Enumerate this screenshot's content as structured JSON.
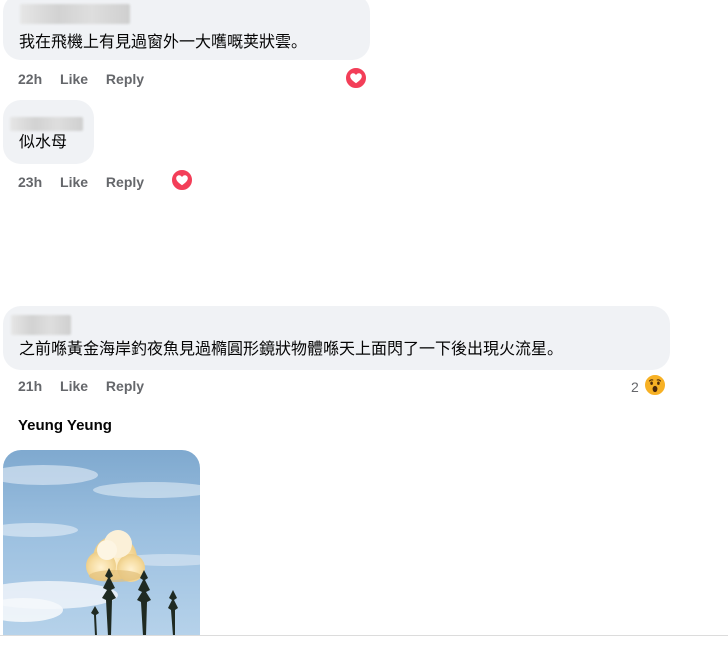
{
  "comments": [
    {
      "text": "我在飛機上有見過窗外一大嚿嘅荚狀雲。",
      "time": "22h",
      "like_label": "Like",
      "reply_label": "Reply",
      "reaction": "love-icon"
    },
    {
      "text": "似水母",
      "time": "23h",
      "like_label": "Like",
      "reply_label": "Reply",
      "reaction": "love-icon"
    },
    {
      "text": "之前喺黃金海岸釣夜魚見過橢圓形鏡狀物體喺天上面閃了一下後出現火流星。",
      "time": "21h",
      "like_label": "Like",
      "reply_label": "Reply",
      "reaction": "wow-icon",
      "reaction_count": "2"
    }
  ],
  "photo_comment": {
    "author": "Yeung Yeung"
  },
  "colors": {
    "bubble": "#f0f2f5",
    "meta_text": "#65676b",
    "love": "#f33e58",
    "wow": "#f7b125"
  }
}
